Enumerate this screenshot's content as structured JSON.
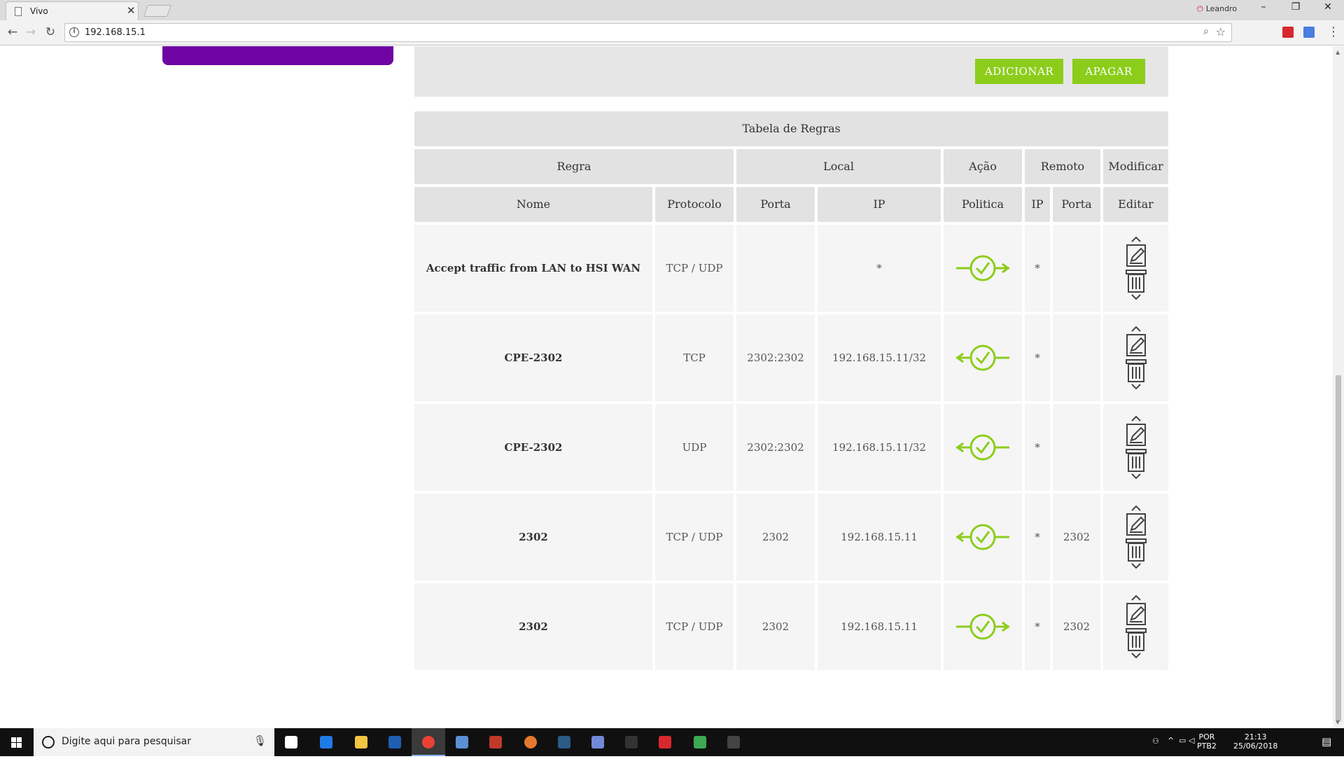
{
  "browser": {
    "tab_title": "Vivo",
    "tab_close": "✕",
    "profile_name": "Leandro",
    "url": "192.168.15.1",
    "window_controls": [
      "–",
      "❐",
      "✕"
    ]
  },
  "actions": {
    "add_label": "ADICIONAR",
    "delete_label": "APAGAR",
    "button_color": "#8ccd1c"
  },
  "table": {
    "title": "Tabela de Regras",
    "groups": {
      "regra": "Regra",
      "local": "Local",
      "acao": "Ação",
      "remoto": "Remoto",
      "modificar": "Modificar"
    },
    "columns": {
      "nome": "Nome",
      "protocolo": "Protocolo",
      "porta_local": "Porta",
      "ip_local": "IP",
      "politica": "Politica",
      "ip_remoto": "IP",
      "porta_remota": "Porta",
      "editar": "Editar"
    },
    "rows": [
      {
        "nome": "Accept traffic from LAN to HSI WAN",
        "protocolo": "TCP / UDP",
        "porta_local": "",
        "ip_local": "*",
        "politica": "outbound-accept",
        "ip_remoto": "*",
        "porta_remota": ""
      },
      {
        "nome": "CPE-2302",
        "protocolo": "TCP",
        "porta_local": "2302:2302",
        "ip_local": "192.168.15.11/32",
        "politica": "inbound-accept",
        "ip_remoto": "*",
        "porta_remota": ""
      },
      {
        "nome": "CPE-2302",
        "protocolo": "UDP",
        "porta_local": "2302:2302",
        "ip_local": "192.168.15.11/32",
        "politica": "inbound-accept",
        "ip_remoto": "*",
        "porta_remota": ""
      },
      {
        "nome": "2302",
        "protocolo": "TCP / UDP",
        "porta_local": "2302",
        "ip_local": "192.168.15.11",
        "politica": "inbound-accept",
        "ip_remoto": "*",
        "porta_remota": "2302"
      },
      {
        "nome": "2302",
        "protocolo": "TCP / UDP",
        "porta_local": "2302",
        "ip_local": "192.168.15.11",
        "politica": "outbound-accept",
        "ip_remoto": "*",
        "porta_remota": "2302"
      }
    ],
    "policy_color": "#8ccd1c"
  },
  "taskbar": {
    "search_placeholder": "Digite aqui para pesquisar",
    "lang_line1": "POR",
    "lang_line2": "PTB2",
    "time": "21:13",
    "date": "25/06/2018",
    "apps": [
      "task-view-icon",
      "edge-icon",
      "file-explorer-icon",
      "shield-app-icon",
      "chrome-icon",
      "vpn-app-icon",
      "app-64-icon",
      "origin-icon",
      "steam-icon",
      "discord-icon",
      "ssd-app-icon",
      "flash-app-icon",
      "image-app-icon",
      "terminal-icon"
    ]
  }
}
